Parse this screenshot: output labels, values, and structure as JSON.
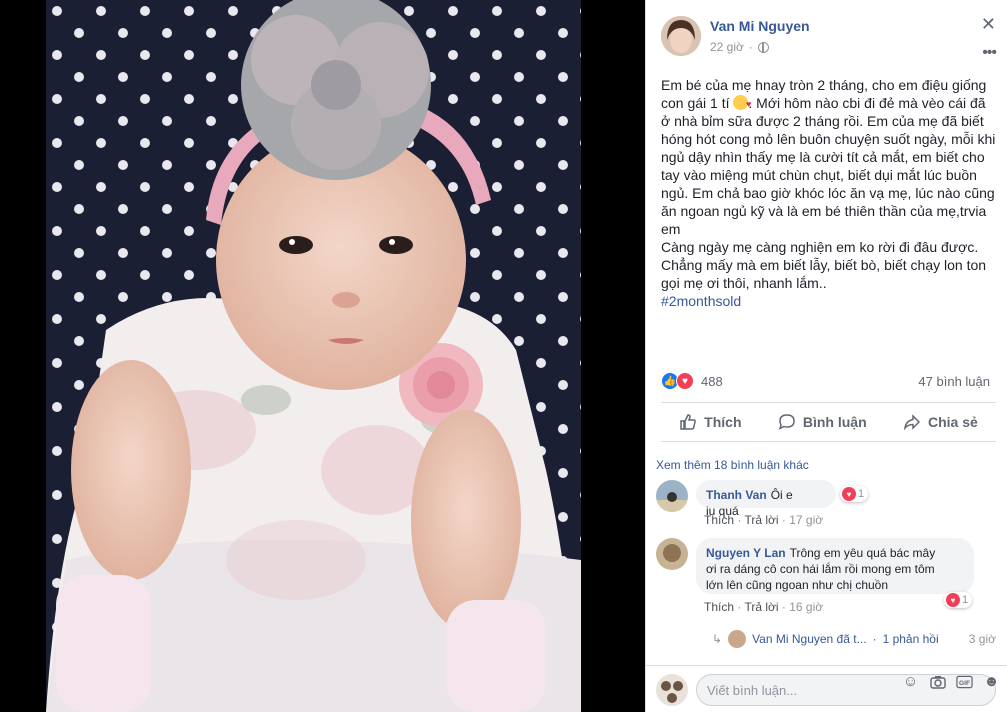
{
  "post": {
    "author": "Van Mi Nguyen",
    "time": "22 giờ",
    "text_paragraphs": [
      "Em bé của mẹ hnay tròn 2 tháng, cho em điệu giống con gái 1 tí",
      ". Mới hôm nào cbi đi đẻ mà vèo cái đã ở nhà bỉm sữa được 2 tháng rồi. Em của mẹ đã biết hóng hót cong mỏ lên buôn chuyện suốt ngày, mỗi khi ngủ dậy nhìn thấy mẹ là cười tít cả mắt, em biết cho tay vào miệng mút chùn chụt, biết dụi mắt lúc buồn ngủ. Em chả bao giờ khóc lóc ăn vạ mẹ, lúc nào cũng ăn ngoan ngủ kỹ và là em bé thiên thần của mẹ,trvia em",
      "Càng ngày mẹ càng nghiện em ko rời đi đâu được. Chẳng mấy mà em biết lẫy, biết bò, biết chạy lon ton gọi mẹ ơi thôi, nhanh lắm.."
    ],
    "hashtag": "#2monthsold",
    "reaction_count": "488",
    "comment_count": "47 bình luận",
    "actions": {
      "like": "Thích",
      "comment": "Bình luận",
      "share": "Chia sẻ"
    }
  },
  "comments_section": {
    "more_comments": "Xem thêm 18 bình luận khác",
    "comments": [
      {
        "name": "Thanh Van",
        "text": "Ôi e iu quá",
        "react_count": "1",
        "like_label": "Thích",
        "reply_label": "Trả lời",
        "time": "17 giờ"
      },
      {
        "name": "Nguyen Y Lan",
        "text_lines": [
          "Trông em yêu quá bác mây",
          "ơi ra dáng cô con hái lắm rồi mong em tôm",
          "lớn lên cũng ngoan như chị chuồn"
        ],
        "react_count": "1",
        "like_label": "Thích",
        "reply_label": "Trả lời",
        "time": "16 giờ"
      }
    ],
    "reply_row": {
      "name": "Van Mi Nguyen đã t...",
      "separator": "·",
      "replies": "1 phản hồi",
      "time": "3 giờ"
    }
  },
  "composer": {
    "placeholder": "Viết bình luận...",
    "gif_label": "GIF"
  },
  "colors": {
    "link": "#385898",
    "like_blue": "#1877f2",
    "love_red": "#f33e58",
    "bubble_bg": "#f2f3f5"
  }
}
